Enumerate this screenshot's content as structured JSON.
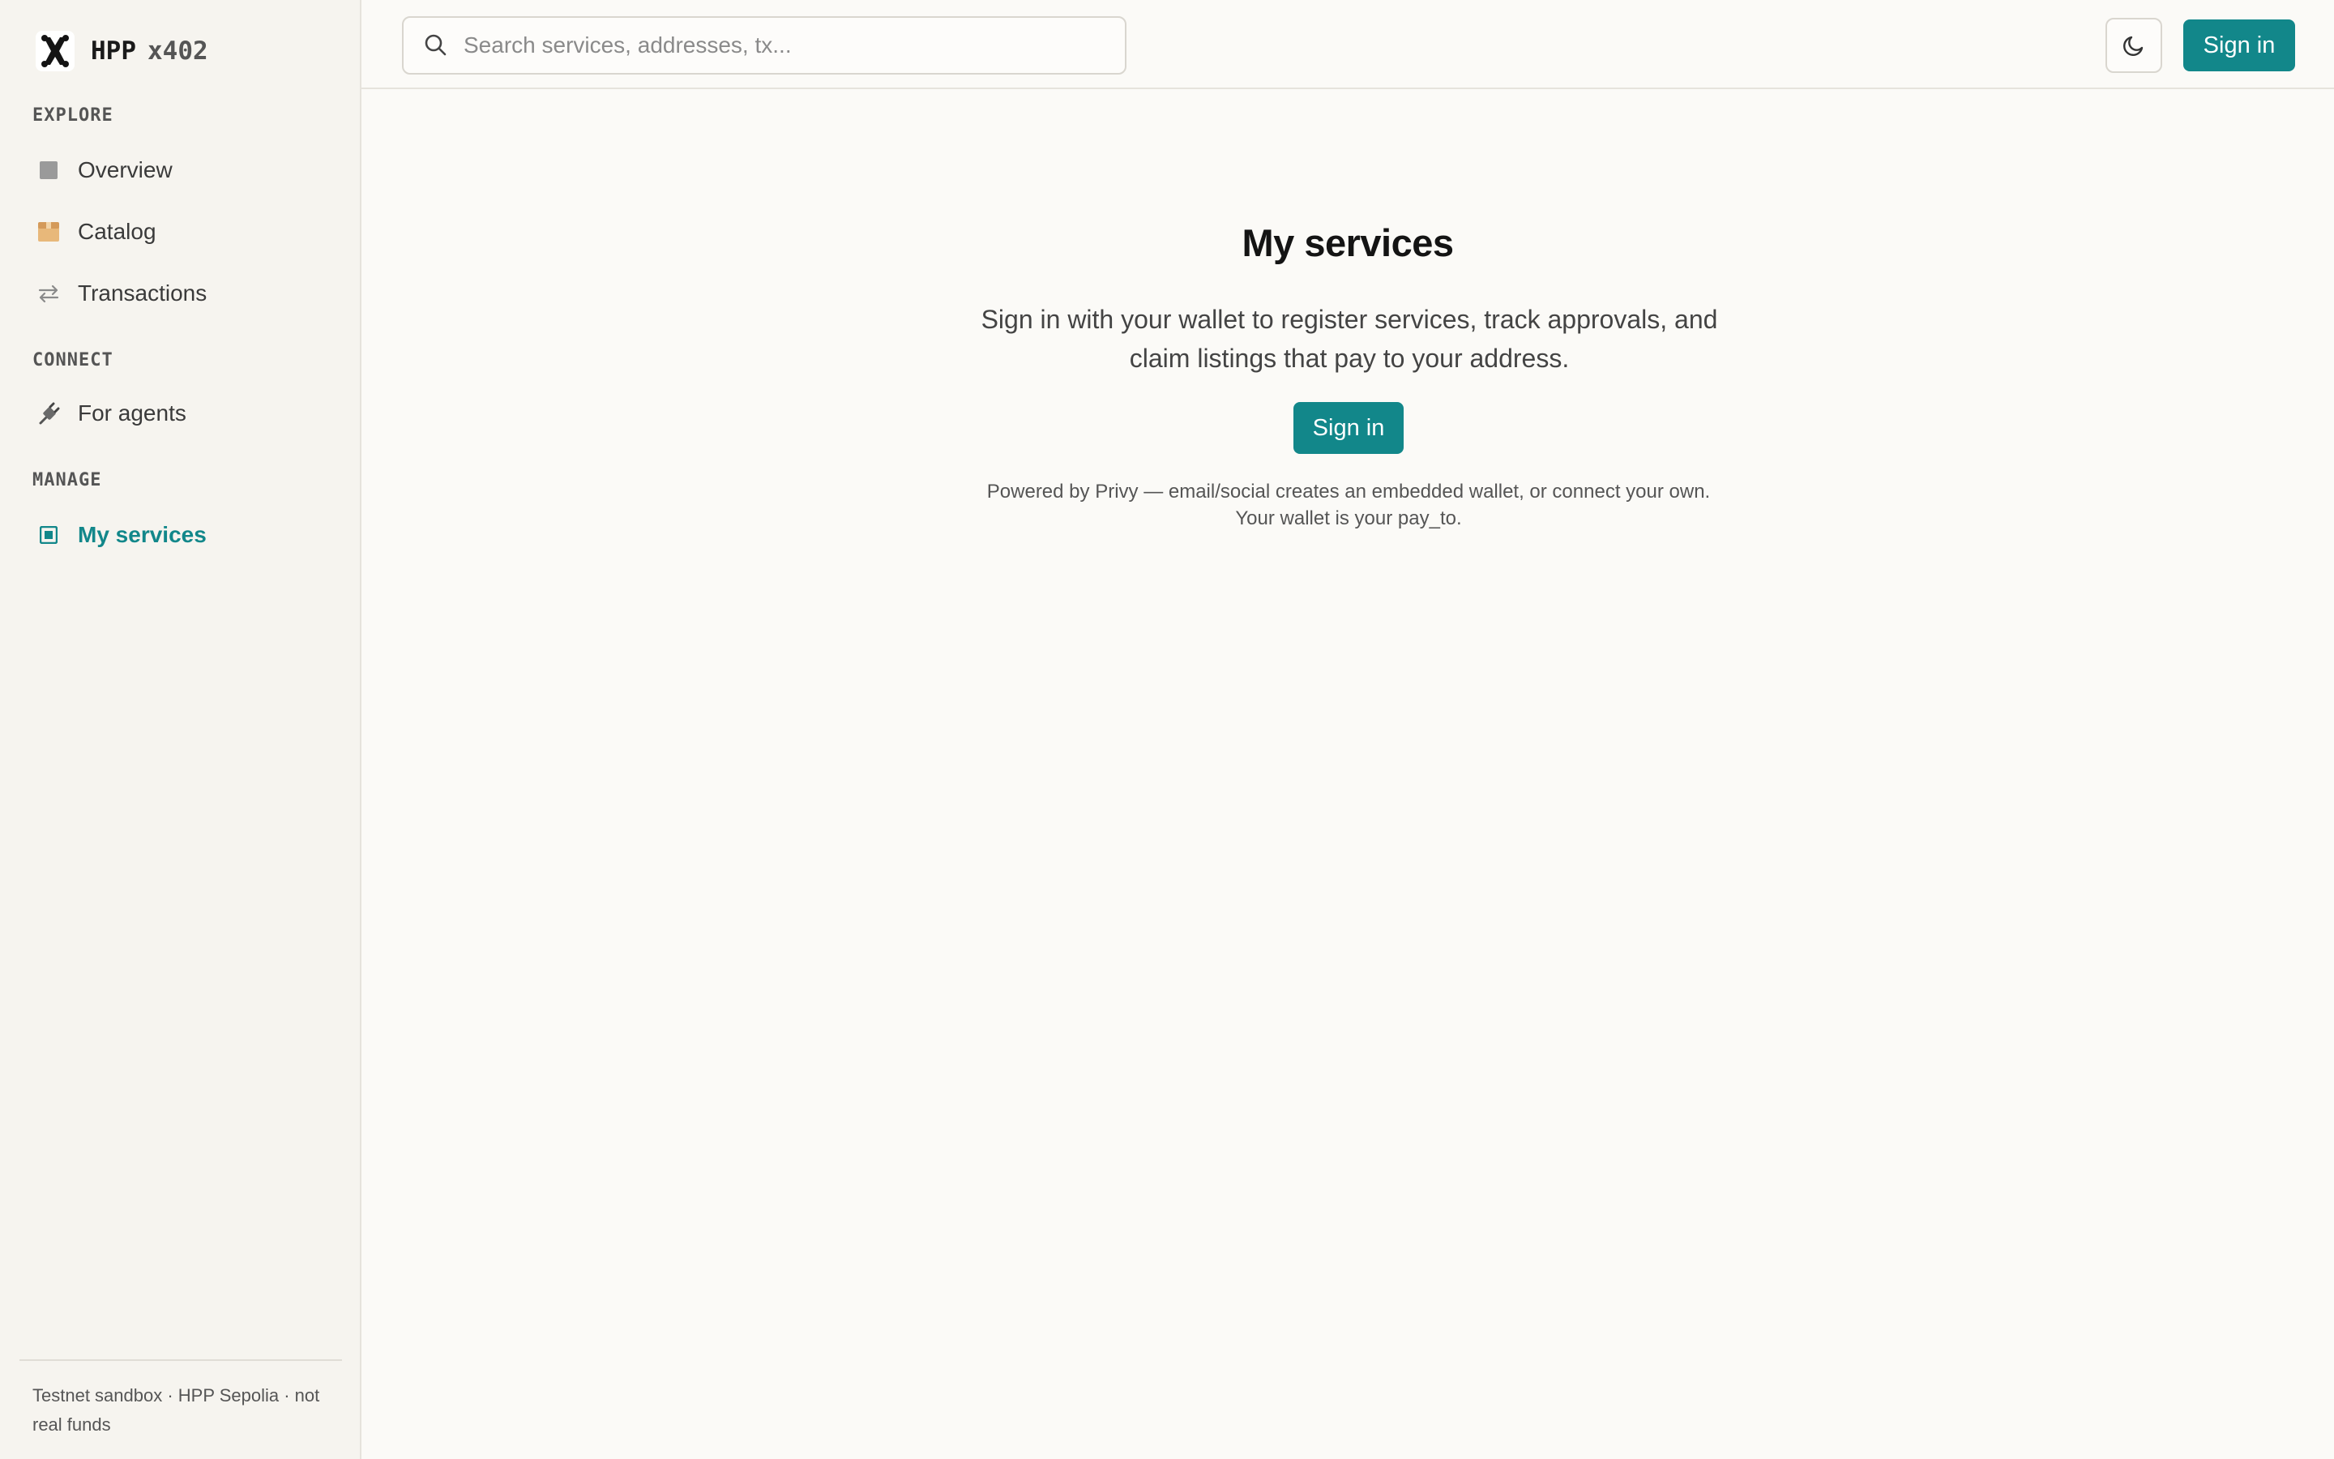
{
  "brand": {
    "name": "HPP",
    "suffix": "x402"
  },
  "sidebar": {
    "sections": {
      "explore": "EXPLORE",
      "connect": "CONNECT",
      "manage": "MANAGE"
    },
    "items": {
      "overview": "Overview",
      "catalog": "Catalog",
      "transactions": "Transactions",
      "for_agents": "For agents",
      "my_services": "My services"
    },
    "active_item": "My services",
    "footer": "Testnet sandbox · HPP Sepolia · not real funds"
  },
  "topbar": {
    "search_placeholder": "Search services, addresses, tx...",
    "theme_toggle_icon": "moon-icon",
    "signin_label": "Sign in"
  },
  "main": {
    "title": "My services",
    "description": "Sign in with your wallet to register services, track approvals, and claim listings that pay to your address.",
    "signin_label": "Sign in",
    "powered_note": "Powered by Privy — email/social creates an embedded wallet, or connect your own. Your wallet is your pay_to."
  },
  "colors": {
    "accent": "#12878a",
    "sidebar_bg": "#f6f4ef",
    "page_bg": "#fbfaf7"
  }
}
